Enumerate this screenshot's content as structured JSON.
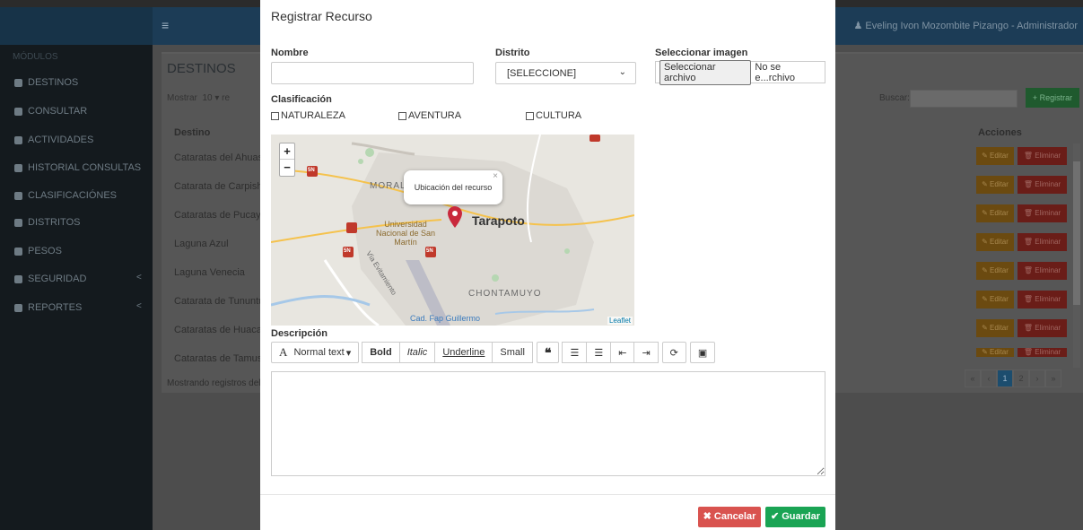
{
  "topbar": {
    "menu_icon": "hamburger-icon",
    "user": "Eveling Ivon Mozombite Pizango - Administrador"
  },
  "sidebar": {
    "header": "MÓDULOS",
    "items": [
      {
        "label": "DESTINOS"
      },
      {
        "label": "CONSULTAR"
      },
      {
        "label": "ACTIVIDADES"
      },
      {
        "label": "HISTORIAL CONSULTAS"
      },
      {
        "label": "CLASIFICACIÓNES"
      },
      {
        "label": "DISTRITOS"
      },
      {
        "label": "PESOS"
      },
      {
        "label": "SEGURIDAD",
        "chevron": "<"
      },
      {
        "label": "REPORTES",
        "chevron": "<"
      }
    ]
  },
  "panel": {
    "title": "DESTINOS",
    "mostrar_label": "Mostrar",
    "mostrar_value": "10",
    "mostrar_suffix": "re",
    "buscar_label": "Buscar:",
    "registrar": "+ Registrar",
    "col_destino": "Destino",
    "col_acciones": "Acciones",
    "rows": [
      "Cataratas del Ahuashi",
      "Catarata de Carpishuy",
      "Cataratas de Pucayac",
      "Laguna Azul",
      "Laguna Venecia",
      "Catarata de Tununtun",
      "Cataratas de Huacam",
      "Cataratas de Tamusha"
    ],
    "edit_label": "Editar",
    "delete_label": "Eliminar",
    "mostrando": "Mostrando registros del",
    "pager": [
      "«",
      "‹",
      "1",
      "2",
      "›",
      "»"
    ]
  },
  "modal": {
    "title": "Registrar Recurso",
    "nombre_label": "Nombre",
    "nombre_value": "",
    "distrito_label": "Distrito",
    "distrito_value": "[SELECCIONE]",
    "imagen_label": "Seleccionar imagen",
    "file_button": "Seleccionar archivo",
    "file_status": "No se e...rchivo",
    "clasificacion_label": "Clasificación",
    "checkboxes": [
      "NATURALEZA",
      "AVENTURA",
      "CULTURA"
    ],
    "map": {
      "zoom_in": "+",
      "zoom_out": "−",
      "popup": "Ubicación del recurso",
      "popup_close": "×",
      "city": "Tarapoto",
      "district_1": "MORALES",
      "district_2": "CHONTAMUYO",
      "university": "Universidad Nacional de San Martín",
      "airport": "Cad. Fap Guillermo",
      "road_label": "Vía Evitamiento",
      "road_shield": "5N",
      "attribution": "Leaflet"
    },
    "descripcion_label": "Descripción",
    "toolbar": {
      "normal_text": "Normal text",
      "bold": "Bold",
      "italic": "Italic",
      "underline": "Underline",
      "small": "Small",
      "quote": "❝"
    },
    "cancel": "Cancelar",
    "save": "Guardar"
  }
}
